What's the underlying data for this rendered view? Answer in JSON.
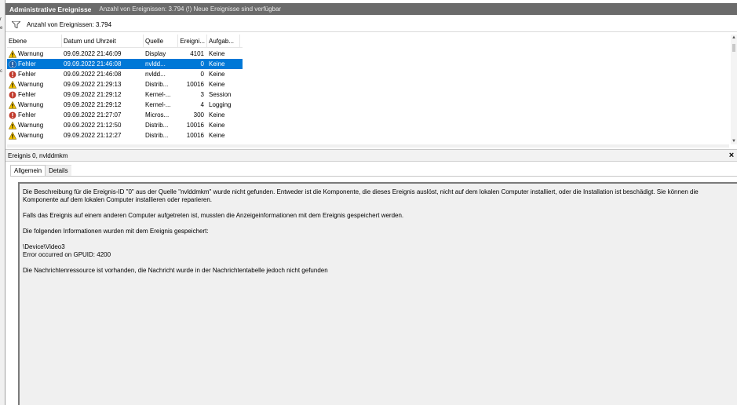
{
  "window": {
    "title": "Administrative Ereignisse",
    "info": "Anzahl von Ereignissen: 3.794 (!) Neue Ereignisse sind verfügbar"
  },
  "filter": {
    "count_label": "Anzahl von Ereignissen: 3.794"
  },
  "left_strip_marks": [
    "r",
    "e",
    "c"
  ],
  "table": {
    "columns": [
      "Ebene",
      "Datum und Uhrzeit",
      "Quelle",
      "Ereigni...",
      "Aufgab..."
    ],
    "rows": [
      {
        "level": "Warnung",
        "icon": "warning-icon",
        "datetime": "09.09.2022 21:46:09",
        "source": "Display",
        "event_id": "4101",
        "task": "Keine"
      },
      {
        "level": "Fehler",
        "icon": "error-icon",
        "datetime": "09.09.2022 21:46:08",
        "source": "nvldd...",
        "event_id": "0",
        "task": "Keine",
        "selected": true
      },
      {
        "level": "Fehler",
        "icon": "error-icon",
        "datetime": "09.09.2022 21:46:08",
        "source": "nvldd...",
        "event_id": "0",
        "task": "Keine"
      },
      {
        "level": "Warnung",
        "icon": "warning-icon",
        "datetime": "09.09.2022 21:29:13",
        "source": "Distrib...",
        "event_id": "10016",
        "task": "Keine"
      },
      {
        "level": "Fehler",
        "icon": "error-icon",
        "datetime": "09.09.2022 21:29:12",
        "source": "Kernel-...",
        "event_id": "3",
        "task": "Session"
      },
      {
        "level": "Warnung",
        "icon": "warning-icon",
        "datetime": "09.09.2022 21:29:12",
        "source": "Kernel-...",
        "event_id": "4",
        "task": "Logging"
      },
      {
        "level": "Fehler",
        "icon": "error-icon",
        "datetime": "09.09.2022 21:27:07",
        "source": "Micros...",
        "event_id": "300",
        "task": "Keine"
      },
      {
        "level": "Warnung",
        "icon": "warning-icon",
        "datetime": "09.09.2022 21:12:50",
        "source": "Distrib...",
        "event_id": "10016",
        "task": "Keine"
      },
      {
        "level": "Warnung",
        "icon": "warning-icon",
        "datetime": "09.09.2022 21:12:27",
        "source": "Distrib...",
        "event_id": "10016",
        "task": "Keine"
      }
    ]
  },
  "detail": {
    "header": "Ereignis 0, nvlddmkm",
    "tabs": [
      "Allgemein",
      "Details"
    ],
    "paragraphs": [
      "Die Beschreibung für die Ereignis-ID \"0\" aus der Quelle \"nvlddmkm\" wurde nicht gefunden. Entweder ist die Komponente, die dieses Ereignis auslöst, nicht auf dem lokalen Computer installiert, oder die Installation ist beschädigt. Sie können die Komponente auf dem lokalen Computer installieren oder reparieren.",
      "Falls das Ereignis auf einem anderen Computer aufgetreten ist, mussten die Anzeigeinformationen mit dem Ereignis gespeichert werden.",
      "Die folgenden Informationen wurden mit dem Ereignis gespeichert:",
      "\\Device\\Video3",
      "Error occurred on GPUID: 4200",
      "Die Nachrichtenressource ist vorhanden, die Nachricht wurde in der Nachrichtentabelle jedoch nicht gefunden"
    ]
  },
  "colors": {
    "titlebar": "#6b6b6b",
    "selection": "#0078d7",
    "warning": "#f5c400",
    "error": "#c0392b",
    "info_panel": "#f0f0f0"
  }
}
